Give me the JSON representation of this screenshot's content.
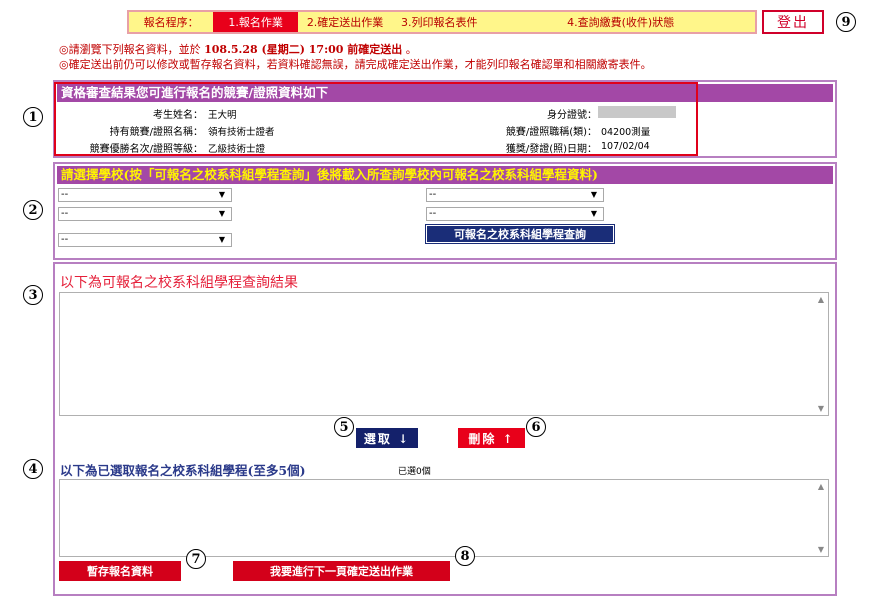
{
  "steps": {
    "label": "報名程序：",
    "items": [
      {
        "label": "1.報名作業",
        "active": true
      },
      {
        "label": "2.確定送出作業",
        "active": false
      },
      {
        "label": "3.列印報名表件",
        "active": false
      },
      {
        "label": "4.查詢繳費(收件)狀態",
        "active": false
      }
    ]
  },
  "logout_label": "登出",
  "notes": {
    "line1_prefix": "◎請瀏覽下列報名資料，並於",
    "line1_deadline": "108.5.28 (星期二) 17:00 前確定送出",
    "line1_suffix": "。",
    "line2": "◎確定送出前仍可以修改或暫存報名資料，若資料確認無誤，請完成確定送出作業，才能列印報名確認單和相關繳寄表件。"
  },
  "qualification": {
    "header": "資格審查結果您可進行報名的競賽/證照資料如下",
    "name_label": "考生姓名：",
    "name_value": "王大明",
    "id_label": "身分證號：",
    "license_label": "持有競賽/證照名稱：",
    "license_value": "領有技術士證者",
    "job_label": "競賽/證照職稱(類)：",
    "job_value": "04200測量",
    "rank_label": "競賽優勝名次/證照等級：",
    "rank_value": "乙級技術士證",
    "date_label": "獲獎/發證(照)日期：",
    "date_value": "107/02/04"
  },
  "school_select": {
    "header_prefix": "請選擇學校(按",
    "header_highlight": "「可報名之校系科組學程查詢」",
    "header_suffix": "後將載入所查詢學校內可報名之校系科組學程資料)",
    "dropdowns": [
      "--",
      "--",
      "--",
      "--",
      "--"
    ],
    "query_button": "可報名之校系科組學程查詢"
  },
  "results": {
    "title": "以下為可報名之校系科組學程查詢結果",
    "select_button": "選取 ↓",
    "delete_button": "刪除 ↑"
  },
  "selected": {
    "title": "以下為已選取報名之校系科組學程(至多5個)",
    "count_text": "已選0個",
    "save_button": "暫存報名資料",
    "next_button": "我要進行下一頁確定送出作業"
  },
  "markers": [
    "1",
    "2",
    "3",
    "4",
    "5",
    "6",
    "7",
    "8",
    "9"
  ],
  "colors": {
    "step_bg": "#fff68a",
    "active_step": "#e8001a",
    "section_header": "#a348a6",
    "query_button": "#1a2d78",
    "highlight_box": "#e0001a"
  }
}
